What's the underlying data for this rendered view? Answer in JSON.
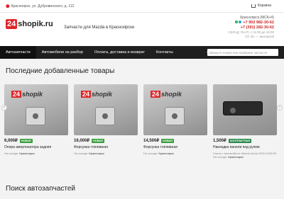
{
  "topbar": {
    "address": "Красноярск, ул. Дубровинского, д. 112",
    "cart_label": "Корзина"
  },
  "header": {
    "logo_num": "24",
    "logo_text": "shopik.ru",
    "tagline": "Запчасти для Mazda в Красноярске",
    "city": "Красноярск (МСК+4)",
    "phone1": "+7 902 982-30-62",
    "phone2": "+7 (391) 282-30-62",
    "hours1": "СКЛАД: Пн-Пт с 11:00 до 19:00",
    "hours2": "Сб, Вс — выходной"
  },
  "nav": {
    "items": [
      "Автозапчасти",
      "Автомобили на разбор",
      "Оплата, доставка и возврат",
      "Контакты"
    ],
    "search_placeholder": "Введите номер или название запчасти"
  },
  "sections": {
    "latest": "Последние добавленные товары",
    "search": "Поиск автозапчастей"
  },
  "products": [
    {
      "price": "6,000₽",
      "badge": "НОВАЯ",
      "name": "Опора амортизатора задняя",
      "extra": "",
      "loc_label": "На складе:",
      "loc": "Красноярск"
    },
    {
      "price": "16,000₽",
      "badge": "НОВАЯ",
      "name": "Форсунка топливная",
      "extra": "",
      "loc_label": "На складе:",
      "loc": "Красноярск"
    },
    {
      "price": "14,500₽",
      "badge": "НОВАЯ",
      "name": "Форсунка топливная",
      "extra": "",
      "loc_label": "На складе:",
      "loc": "Красноярск"
    },
    {
      "price": "1,500₽",
      "badge": "КОНТРАКТНАЯ",
      "name": "Накладка панели под рулем",
      "extra": "Снята с автомобиля: Mazda Axela 2003-2009 BK",
      "loc_label": "На складе:",
      "loc": "Красноярск"
    }
  ],
  "banner_brand": {
    "num": "24",
    "text": "shopik"
  },
  "colors": {
    "accent": "#e0262a",
    "nav_bg": "#1f1f1f",
    "badge_green": "#3a9e3f"
  }
}
